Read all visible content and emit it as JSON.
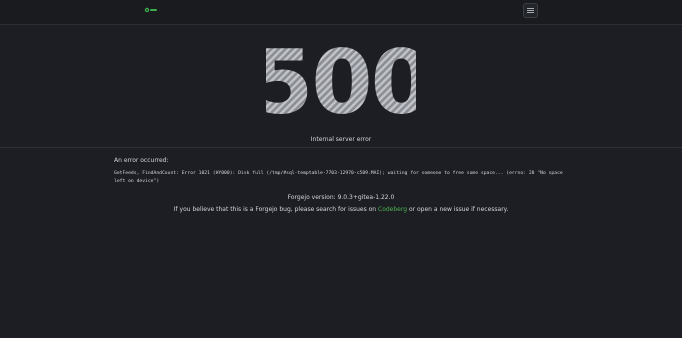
{
  "header": {
    "logo_icon": "forgejo-logo-icon",
    "menu_icon": "hamburger-menu-icon"
  },
  "error": {
    "code": "500",
    "title": "Internal server error",
    "occurred_label": "An error occurred:",
    "detail": "GetFeeds, FindAndCount: Error 1021 (HY000): Disk full (/tmp/#sql-temptable-7703-12970-c509.MAI); waiting for someone to free some space... (errno: 28 \"No space left on device\")"
  },
  "footer": {
    "version": "Forgejo version: 9.0.3+gitea-1.22.0",
    "bug_prefix": "If you believe that this is a Forgejo bug, please search for issues on ",
    "bug_link": "Codeberg",
    "bug_suffix": " or open a new issue if necessary."
  },
  "colors": {
    "background": "#1c1e23",
    "link": "#4fb353"
  }
}
